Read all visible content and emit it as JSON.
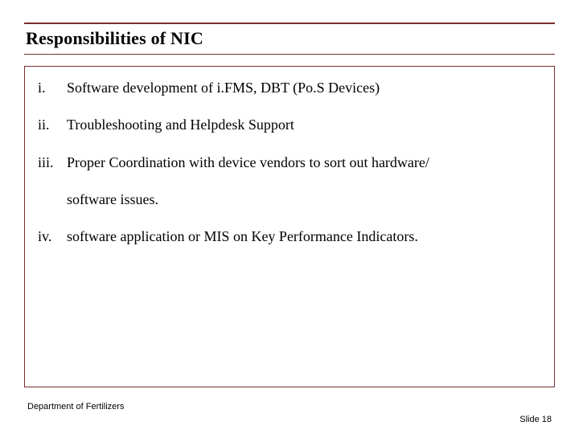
{
  "slide": {
    "title": "Responsibilities of NIC",
    "items": {
      "i1": "Software development of i.FMS, DBT (Po.S Devices)",
      "i2": "Troubleshooting and Helpdesk Support",
      "i3a": "Proper Coordination with device vendors to sort out hardware/",
      "i3b": "software issues.",
      "i4": "software application or MIS on Key Performance Indicators."
    },
    "footer": {
      "left": "Department of Fertilizers",
      "right": "Slide 18"
    }
  }
}
